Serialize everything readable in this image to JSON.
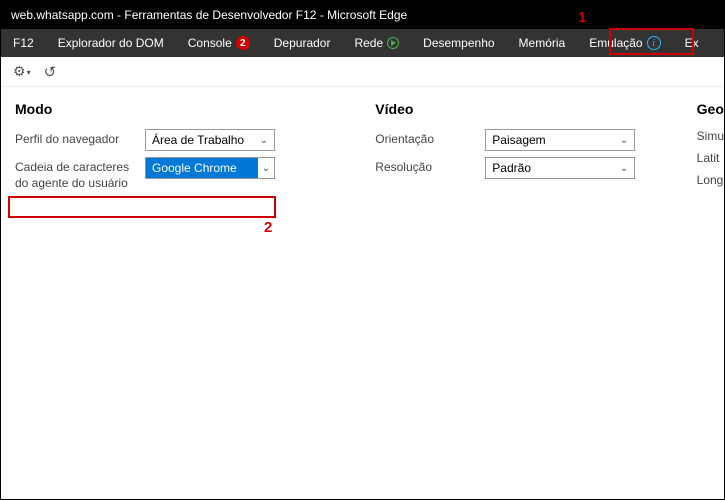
{
  "window": {
    "title": "web.whatsapp.com - Ferramentas de Desenvolvedor F12 - Microsoft Edge"
  },
  "tabs": {
    "f12": "F12",
    "dom": "Explorador do DOM",
    "console": "Console",
    "console_badge": "2",
    "debugger": "Depurador",
    "network": "Rede",
    "performance": "Desempenho",
    "memory": "Memória",
    "emulation": "Emulação",
    "extra": "Ex"
  },
  "sections": {
    "mode": {
      "title": "Modo",
      "browser_profile_label": "Perfil do navegador",
      "browser_profile_value": "Área de Trabalho",
      "ua_label": "Cadeia de caracteres do agente do usuário",
      "ua_value": "Google Chrome"
    },
    "video": {
      "title": "Vídeo",
      "orientation_label": "Orientação",
      "orientation_value": "Paisagem",
      "resolution_label": "Resolução",
      "resolution_value": "Padrão"
    },
    "geo": {
      "title": "Geo",
      "sim": "Simu",
      "lat": "Latit",
      "lon": "Long"
    }
  },
  "annotations": {
    "one": "1",
    "two": "2"
  }
}
